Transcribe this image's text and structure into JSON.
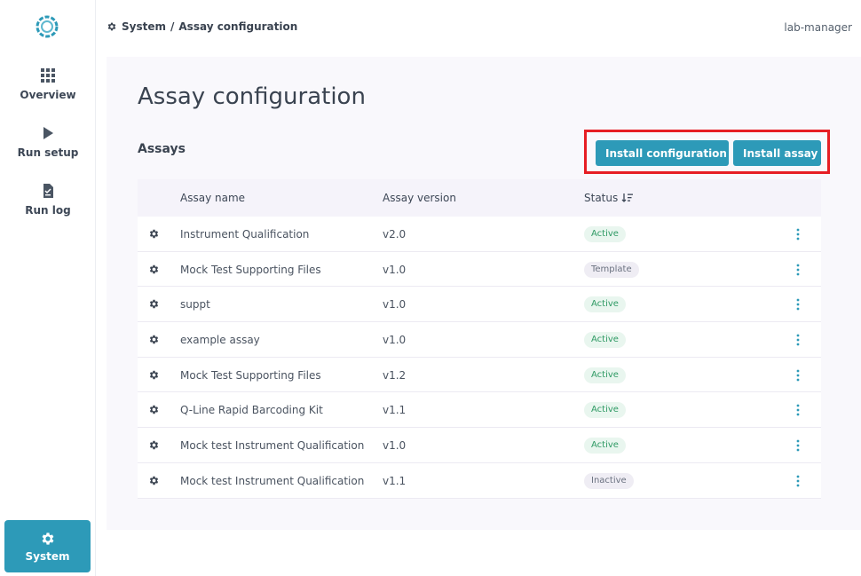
{
  "app": {
    "user": "lab-manager"
  },
  "sidebar": {
    "items": [
      {
        "label": "Overview",
        "icon": "grid-icon"
      },
      {
        "label": "Run setup",
        "icon": "play-icon"
      },
      {
        "label": "Run log",
        "icon": "document-icon"
      }
    ],
    "system": {
      "label": "System",
      "icon": "gear-icon"
    }
  },
  "breadcrumb": {
    "section": "System",
    "separator": "/",
    "current": "Assay configuration"
  },
  "page": {
    "title": "Assay configuration",
    "section_title": "Assays"
  },
  "actions": {
    "install_configuration": "Install configuration",
    "install_assay": "Install assay",
    "highlight_color": "#e61e24"
  },
  "table": {
    "headers": {
      "name": "Assay name",
      "version": "Assay version",
      "status": "Status"
    },
    "rows": [
      {
        "name": "Instrument Qualification",
        "version": "v2.0",
        "status": "Active"
      },
      {
        "name": "Mock Test Supporting Files",
        "version": "v1.0",
        "status": "Template"
      },
      {
        "name": "suppt",
        "version": "v1.0",
        "status": "Active"
      },
      {
        "name": "example assay",
        "version": "v1.0",
        "status": "Active"
      },
      {
        "name": "Mock Test Supporting Files",
        "version": "v1.2",
        "status": "Active"
      },
      {
        "name": "Q-Line Rapid Barcoding Kit",
        "version": "v1.1",
        "status": "Active"
      },
      {
        "name": "Mock test Instrument Qualification",
        "version": "v1.0",
        "status": "Active"
      },
      {
        "name": "Mock test Instrument Qualification",
        "version": "v1.1",
        "status": "Inactive"
      }
    ]
  },
  "colors": {
    "accent": "#2d9ab8",
    "active_badge_text": "#2f9a64",
    "active_badge_bg": "#e9f6ef"
  }
}
